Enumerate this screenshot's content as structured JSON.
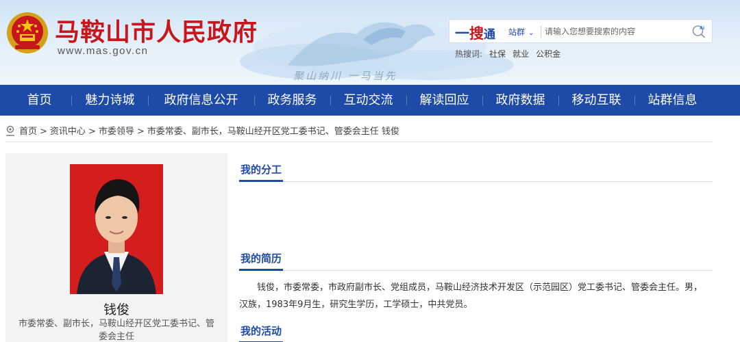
{
  "header": {
    "site_title": "马鞍山市人民政府",
    "site_url": "www.mas.gov.cn",
    "slogan": "聚山纳川 一马当先",
    "search": {
      "brand_dash": "一",
      "brand_sou": "搜",
      "brand_tong": "通",
      "scope_label": "站群",
      "placeholder": "请输入您想要搜索的内容"
    },
    "hot_label": "热搜词:",
    "hot_keywords": [
      "社保",
      "就业",
      "公积金"
    ]
  },
  "nav": [
    "首页",
    "魅力诗城",
    "政府信息公开",
    "政务服务",
    "互动交流",
    "解读回应",
    "政府数据",
    "移动互联",
    "站群信息"
  ],
  "breadcrumb": [
    "首页",
    "资讯中心",
    "市委领导",
    "市委常委、副市长，马鞍山经开区党工委书记、管委会主任 钱俊"
  ],
  "profile": {
    "name": "钱俊",
    "title": "市委常委、副市长，马鞍山经开区党工委书记、管委会主任"
  },
  "sections": {
    "division": "我的分工",
    "resume": "我的简历",
    "activities": "我的活动"
  },
  "bio": "钱俊，市委常委，市政府副市长、党组成员，马鞍山经济技术开发区（示范园区）党工委书记、管委会主任。男，汉族，1983年9月生，研究生学历，工学硕士，中共党员。",
  "colors": {
    "nav_blue": "#1e4aa8",
    "title_red": "#c8161d"
  }
}
